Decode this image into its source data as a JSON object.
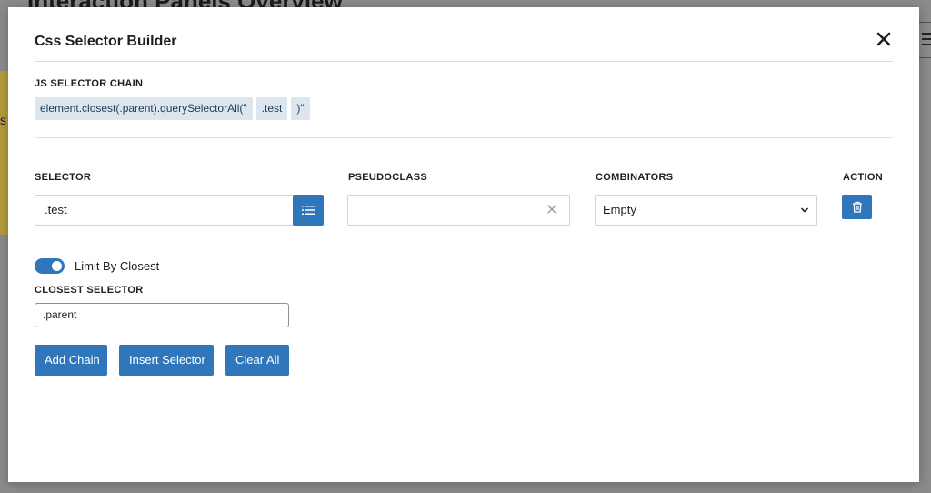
{
  "backdrop": {
    "title": "Interaction Panels Overview",
    "edge_text": "s"
  },
  "modal": {
    "title": "Css Selector Builder",
    "close_icon": "close-icon",
    "chain": {
      "label": "JS SELECTOR CHAIN",
      "parts": [
        "element.closest(.parent).querySelectorAll(\"",
        ".test",
        ")\""
      ]
    },
    "columns": {
      "selector": "SELECTOR",
      "pseudoclass": "PSEUDOCLASS",
      "combinators": "COMBINATORS",
      "action": "ACTION"
    },
    "selector_value": ".test",
    "pseudoclass_value": "",
    "combinator_value": "Empty",
    "limit_by_closest": {
      "label": "Limit By Closest",
      "enabled": true
    },
    "closest_selector": {
      "label": "CLOSEST SELECTOR",
      "value": ".parent"
    },
    "buttons": {
      "add_chain": "Add Chain",
      "insert_selector": "Insert Selector",
      "clear_all": "Clear All"
    },
    "colors": {
      "accent": "#2f76bb",
      "chip_bg": "#dde6ef"
    }
  }
}
